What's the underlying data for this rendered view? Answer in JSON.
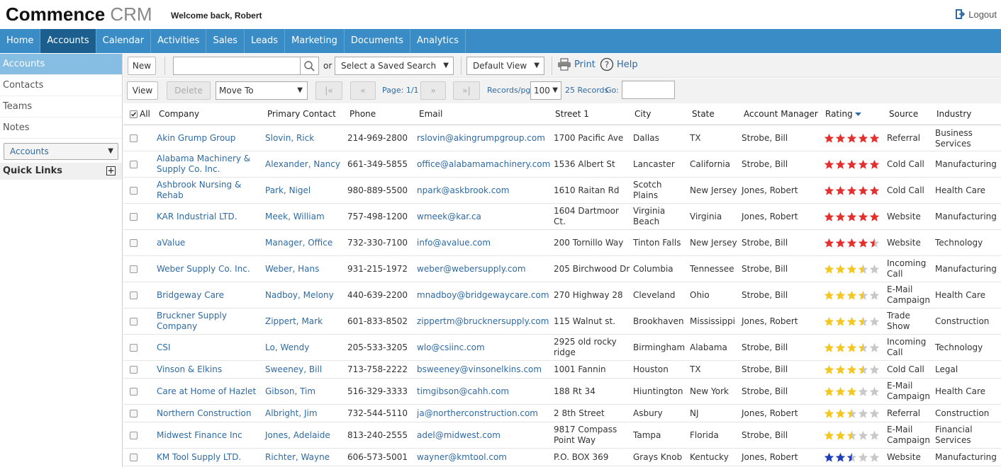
{
  "header": {
    "logo_bold": "Commence",
    "logo_light": " CRM",
    "welcome": "Welcome back, Robert",
    "logout": "Logout"
  },
  "nav": [
    "Home",
    "Accounts",
    "Calendar",
    "Activities",
    "Sales",
    "Leads",
    "Marketing",
    "Documents",
    "Analytics"
  ],
  "nav_active": "Accounts",
  "sidebar": {
    "items": [
      "Accounts",
      "Contacts",
      "Teams",
      "Notes"
    ],
    "select_value": "Accounts",
    "quick_links": "Quick Links"
  },
  "toolbar": {
    "new": "New",
    "or": "or",
    "saved_search": "Select a Saved Search",
    "default_view": "Default View",
    "print": "Print",
    "help": "Help",
    "view": "View",
    "delete": "Delete",
    "move_to": "Move To",
    "first": "|«",
    "prev": "«",
    "page": "Page: 1/1",
    "next": "»",
    "last": "»|",
    "records_per_page_label": "Records/pg:",
    "records_per_page": "100",
    "records_count": "25 Records",
    "go": "Go:"
  },
  "columns": {
    "all": "All",
    "company": "Company",
    "contact": "Primary Contact",
    "phone": "Phone",
    "email": "Email",
    "street": "Street 1",
    "city": "City",
    "state": "State",
    "manager": "Account Manager",
    "rating": "Rating",
    "source": "Source",
    "industry": "Industry"
  },
  "colors": {
    "nav_bg": "#3a8cc6",
    "nav_active": "#1c5f8e",
    "link": "#2e6aa3",
    "star_red": "#e2302f",
    "star_yellow": "#f3c625",
    "star_blue": "#1f3db7",
    "star_empty": "#c8c8c8"
  },
  "rows": [
    {
      "company": "Akin Grump Group",
      "contact": "Slovin, Rick",
      "phone": "214-969-2800",
      "email": "rslovin@akingrumpgroup.com",
      "street": "1700 Pacific Ave",
      "city": "Dallas",
      "state": "TX",
      "manager": "Strobe, Bill",
      "rating": 5,
      "star_color": "red",
      "source": "Referral",
      "industry": "Business Services"
    },
    {
      "company": "Alabama Machinery & Supply Co. Inc.",
      "contact": "Alexander, Nancy",
      "phone": "661-349-5855",
      "email": "office@alabamamachinery.com",
      "street": "1536 Albert St",
      "city": "Lancaster",
      "state": "California",
      "manager": "Strobe, Bill",
      "rating": 5,
      "star_color": "red",
      "source": "Cold Call",
      "industry": "Manufacturing"
    },
    {
      "company": "Ashbrook Nursing & Rehab",
      "contact": "Park, Nigel",
      "phone": "980-889-5500",
      "email": "npark@askbrook.com",
      "street": "1610 Raitan Rd",
      "city": "Scotch Plains",
      "state": "New Jersey",
      "manager": "Jones, Robert",
      "rating": 5,
      "star_color": "red",
      "source": "Cold Call",
      "industry": "Health Care"
    },
    {
      "company": "KAR Industrial LTD.",
      "contact": "Meek, William",
      "phone": "757-498-1200",
      "email": "wmeek@kar.ca",
      "street": "1604 Dartmoor Ct.",
      "city": "Virginia Beach",
      "state": "Virginia",
      "manager": "Jones, Robert",
      "rating": 5,
      "star_color": "red",
      "source": "Website",
      "industry": "Manufacturing"
    },
    {
      "company": "aValue",
      "contact": "Manager, Office",
      "phone": "732-330-7100",
      "email": "info@avalue.com",
      "street": "200 Tornillo Way",
      "city": "Tinton Falls",
      "state": "New Jersey",
      "manager": "Strobe, Bill",
      "rating": 4.5,
      "star_color": "red",
      "source": "Website",
      "industry": "Technology"
    },
    {
      "company": "Weber Supply Co. Inc.",
      "contact": "Weber, Hans",
      "phone": "931-215-1972",
      "email": "weber@webersupply.com",
      "street": "205 Birchwood Dr",
      "city": "Columbia",
      "state": "Tennessee",
      "manager": "Strobe, Bill",
      "rating": 3.5,
      "star_color": "yellow",
      "source": "Incoming Call",
      "industry": "Manufacturing"
    },
    {
      "company": "Bridgeway Care",
      "contact": "Nadboy, Melony",
      "phone": "440-639-2200",
      "email": "mnadboy@bridgewaycare.com",
      "street": "270 Highway 28",
      "city": "Cleveland",
      "state": "Ohio",
      "manager": "Strobe, Bill",
      "rating": 3.5,
      "star_color": "yellow",
      "source": "E-Mail Campaign",
      "industry": "Health Care"
    },
    {
      "company": "Bruckner Supply Company",
      "contact": "Zippert, Mark",
      "phone": "601-833-8502",
      "email": "zippertm@brucknersupply.com",
      "street": "115 Walnut st.",
      "city": "Brookhaven",
      "state": "Mississippi",
      "manager": "Jones, Robert",
      "rating": 3.5,
      "star_color": "yellow",
      "source": "Trade Show",
      "industry": "Construction"
    },
    {
      "company": "CSI",
      "contact": "Lo, Wendy",
      "phone": "205-533-3205",
      "email": "wlo@csiinc.com",
      "street": "2925 old rocky ridge",
      "city": "Birmingham",
      "state": "Alabama",
      "manager": "Strobe, Bill",
      "rating": 3.5,
      "star_color": "yellow",
      "source": "Incoming Call",
      "industry": "Technology"
    },
    {
      "company": "Vinson & Elkins",
      "contact": "Sweeney, Bill",
      "phone": "713-758-2222",
      "email": "bsweeney@vinsonelkins.com",
      "street": "1001 Fannin",
      "city": "Houston",
      "state": "TX",
      "manager": "Strobe, Bill",
      "rating": 3.5,
      "star_color": "yellow",
      "source": "Cold Call",
      "industry": "Legal"
    },
    {
      "company": "Care at Home of Hazlet",
      "contact": "Gibson, Tim",
      "phone": "516-329-3333",
      "email": "timgibson@cahh.com",
      "street": "188 Rt 34",
      "city": "Hiuntington",
      "state": "New York",
      "manager": "Strobe, Bill",
      "rating": 3,
      "star_color": "yellow",
      "source": "E-Mail Campaign",
      "industry": "Health Care"
    },
    {
      "company": "Northern Construction",
      "contact": "Albright, Jim",
      "phone": "732-544-5110",
      "email": "ja@northerconstruction.com",
      "street": "2 8th Street",
      "city": "Asbury",
      "state": "NJ",
      "manager": "Jones, Robert",
      "rating": 2.5,
      "star_color": "yellow",
      "source": "Referral",
      "industry": "Construction"
    },
    {
      "company": "Midwest Finance Inc",
      "contact": "Jones, Adelaide",
      "phone": "813-240-2555",
      "email": "adel@midwest.com",
      "street": "9817 Compass Point Way",
      "city": "Tampa",
      "state": "Florida",
      "manager": "Strobe, Bill",
      "rating": 2.5,
      "star_color": "yellow",
      "source": "E-Mail Campaign",
      "industry": "Financial Services"
    },
    {
      "company": "KM Tool Supply LTD.",
      "contact": "Richter, Wayne",
      "phone": "606-573-5001",
      "email": "wayner@kmtool.com",
      "street": "P.O. BOX 369",
      "city": "Grays Knob",
      "state": "Kentucky",
      "manager": "Jones, Robert",
      "rating": 2.5,
      "star_color": "blue",
      "source": "Website",
      "industry": "Manufacturing"
    }
  ]
}
